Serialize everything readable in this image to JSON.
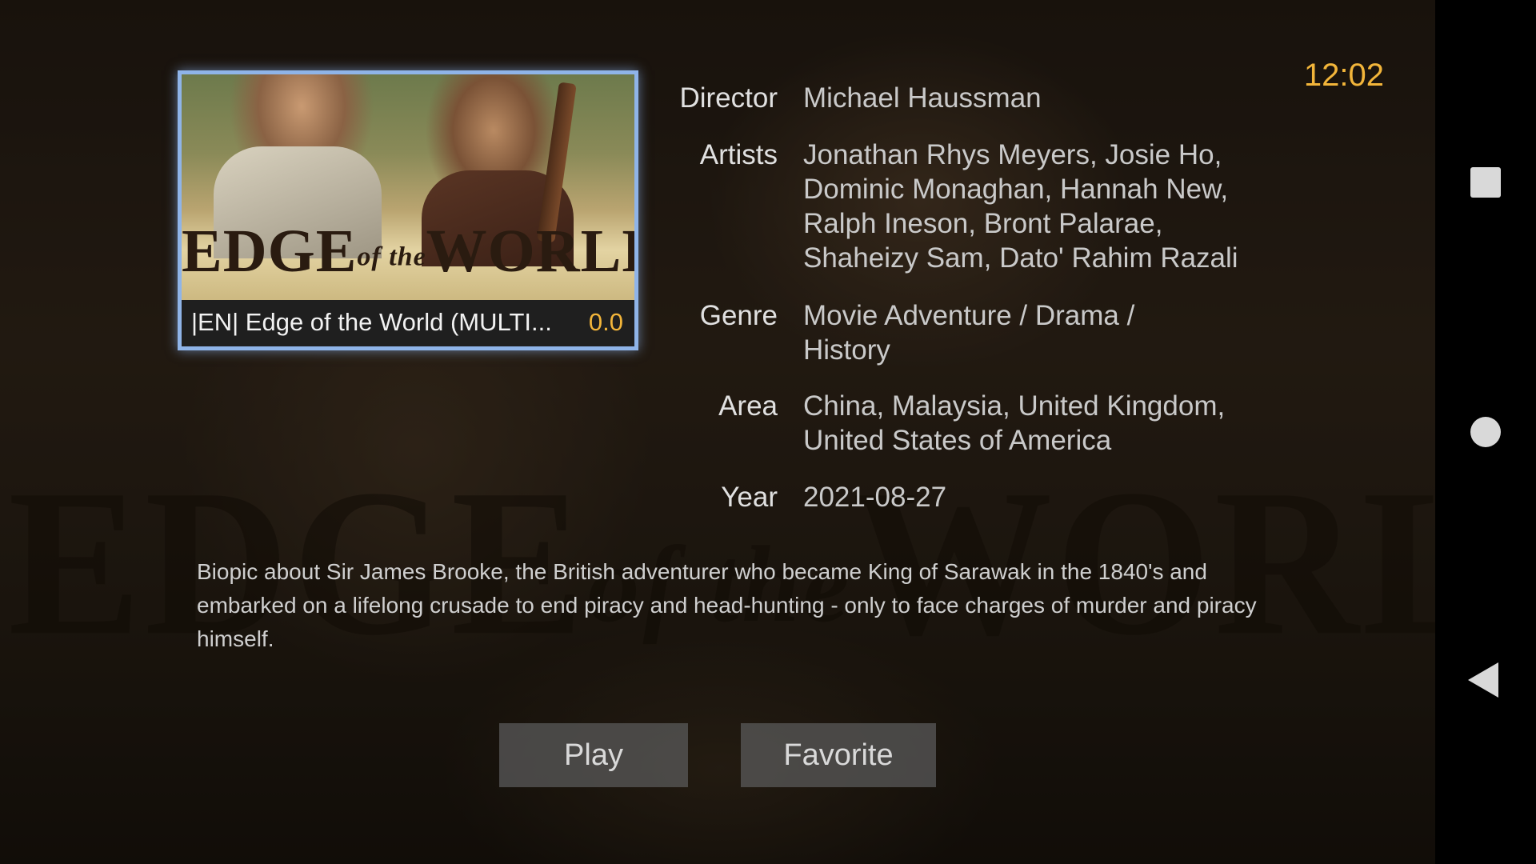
{
  "clock": "12:02",
  "poster": {
    "logo_main_1": "EDGE",
    "logo_small": "of the",
    "logo_main_2": "WORLD",
    "caption_title": "|EN| Edge of the World (MULTI...",
    "rating": "0.0",
    "border_color": "#8fb4e8"
  },
  "backdrop": {
    "title_1": "EDGE",
    "title_small": "of the",
    "title_2": "WORLD"
  },
  "details": {
    "director_label": "Director",
    "director_value": "Michael Haussman",
    "artists_label": "Artists",
    "artists_value": "Jonathan Rhys Meyers, Josie Ho, Dominic Monaghan, Hannah New, Ralph Ineson, Bront Palarae, Shaheizy Sam, Dato' Rahim Razali",
    "genre_label": "Genre",
    "genre_value": "Movie  Adventure / Drama / History",
    "area_label": "Area",
    "area_value": "China, Malaysia, United Kingdom, United States of America",
    "year_label": "Year",
    "year_value": "2021-08-27"
  },
  "description": "Biopic about Sir James Brooke, the British adventurer who became King of Sarawak in the 1840's and embarked on a lifelong crusade to end piracy and head-hunting - only to face charges of murder and piracy himself.",
  "buttons": {
    "play": "Play",
    "favorite": "Favorite"
  },
  "navbar": {
    "recents_icon": "square-icon",
    "home_icon": "circle-icon",
    "back_icon": "triangle-back-icon"
  },
  "colors": {
    "accent": "#f2b53a",
    "focus": "#8fb4e8"
  }
}
